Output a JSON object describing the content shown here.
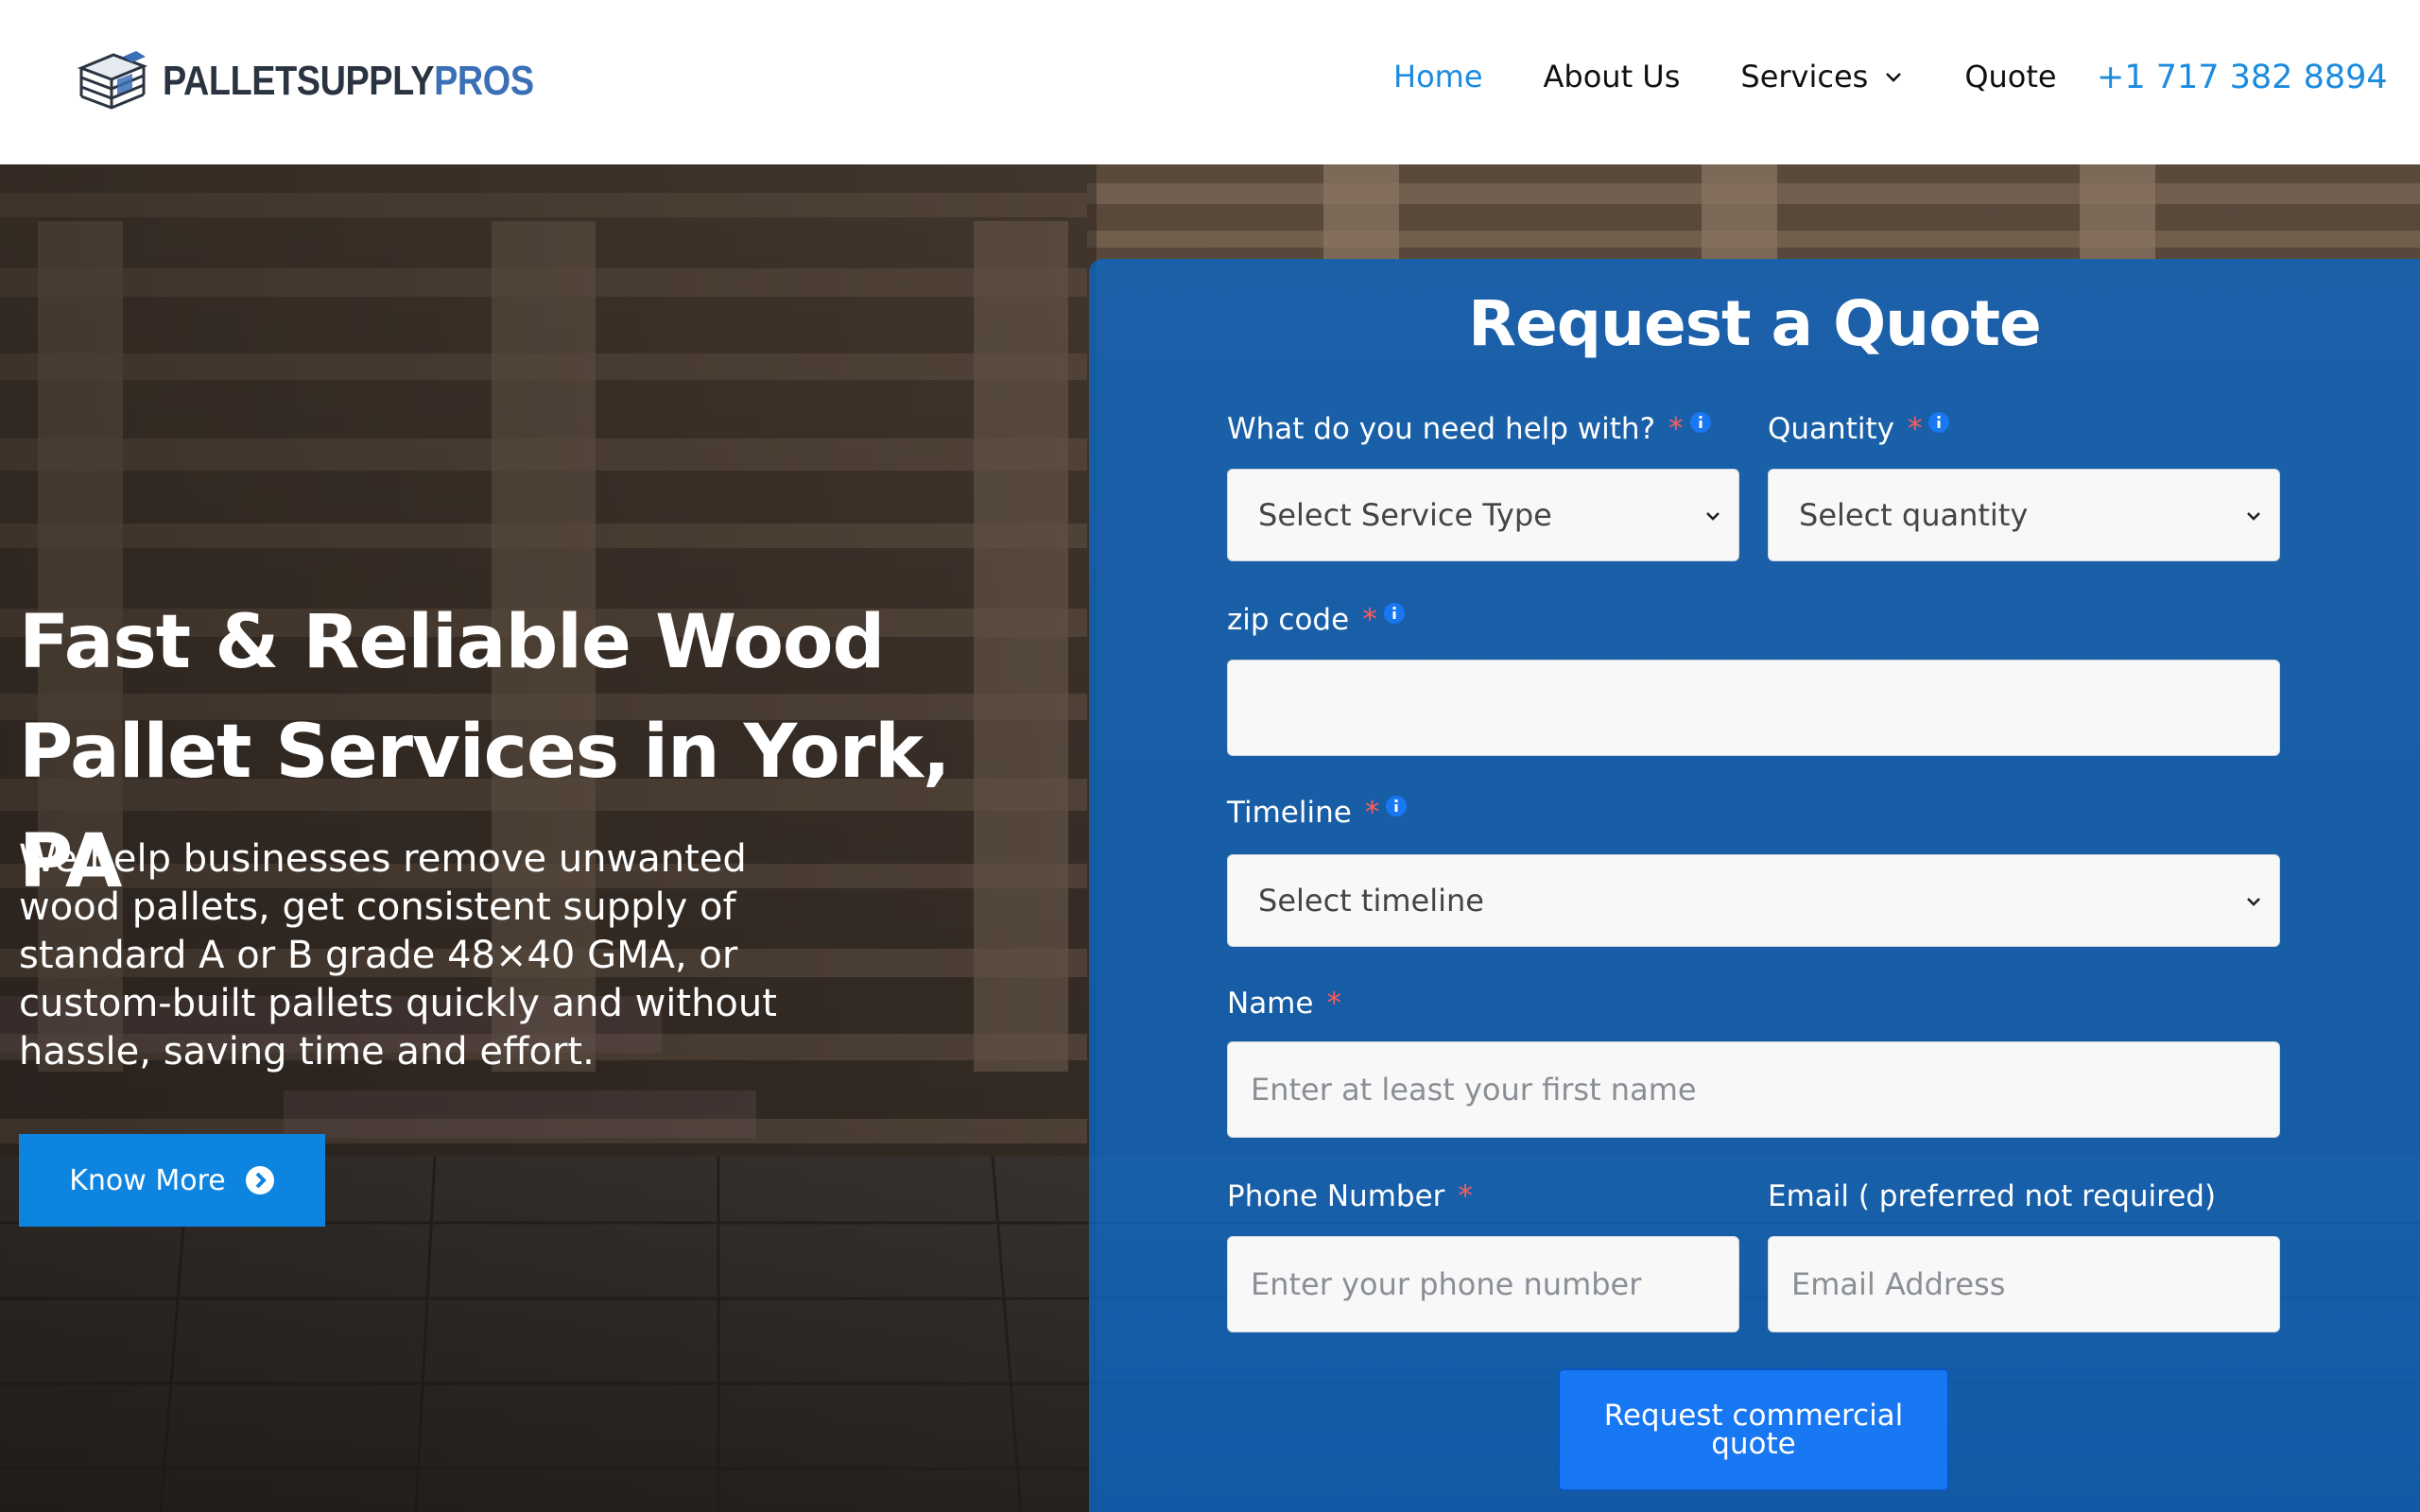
{
  "brand": {
    "logo_dark": "PALLETSUPPLY",
    "logo_blue": "PROS",
    "logo_icon": "pallet-stack-icon",
    "color_dark": "#2a3440",
    "color_blue": "#3b6fb6"
  },
  "nav": {
    "items": [
      {
        "label": "Home",
        "active": true
      },
      {
        "label": "About Us"
      },
      {
        "label": "Services",
        "has_dropdown": true
      },
      {
        "label": "Quote"
      }
    ],
    "phone": "+1 717 382 8894",
    "accent": "#1b8be0"
  },
  "hero": {
    "title": "Fast & Reliable Wood Pallet Services in York, PA",
    "subtitle": "We help businesses remove unwanted wood pallets, get consistent supply of standard A or B grade 48×40 GMA, or custom-built pallets quickly and without hassle, saving time and effort.",
    "button_label": "Know More",
    "button_icon": "arrow-right-circle-icon",
    "button_color": "#0d85e0"
  },
  "form": {
    "title": "Request a Quote",
    "service": {
      "label": "What do you need help with?",
      "required": "*",
      "value": "Select Service Type"
    },
    "quantity": {
      "label": "Quantity",
      "required": "*",
      "value": "Select quantity"
    },
    "zip": {
      "label": "zip code",
      "required": "*",
      "value": ""
    },
    "timeline": {
      "label": "Timeline",
      "required": "*",
      "value": "Select timeline"
    },
    "name": {
      "label": "Name",
      "required": "*",
      "placeholder": "Enter at least your first name"
    },
    "phone": {
      "label": "Phone Number",
      "required": "*",
      "placeholder": "Enter your phone number"
    },
    "email": {
      "label": "Email ( preferred not required)",
      "placeholder": "Email Address"
    },
    "submit_label": "Request commercial quote",
    "panel_color": "#0a68c8",
    "submit_color": "#1877f2"
  }
}
